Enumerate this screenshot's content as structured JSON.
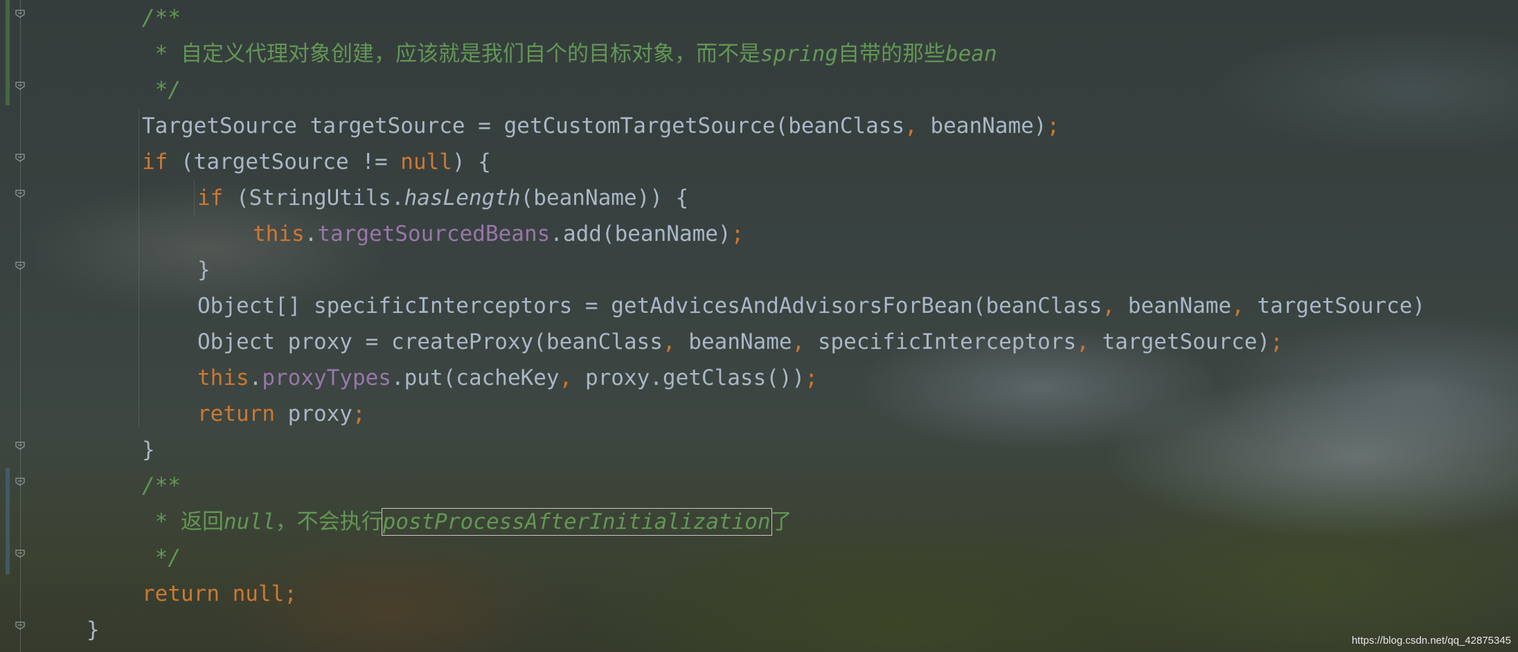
{
  "editor": {
    "lines": [
      {
        "tokens": [
          {
            "t": "/**",
            "c": "cm it"
          }
        ]
      },
      {
        "tokens": [
          {
            "t": " * ",
            "c": "cm it"
          },
          {
            "t": "自定义代理对象创建，应该就是我们自个的目标对象，而不是",
            "c": "cm"
          },
          {
            "t": "spring",
            "c": "cm it"
          },
          {
            "t": "自带的那些",
            "c": "cm"
          },
          {
            "t": "bean",
            "c": "cm it"
          }
        ]
      },
      {
        "tokens": [
          {
            "t": " */",
            "c": "cm it"
          }
        ]
      },
      {
        "tokens": [
          {
            "t": "TargetSource targetSource = getCustomTargetSource(beanClass",
            "c": ""
          },
          {
            "t": ", ",
            "c": "kw"
          },
          {
            "t": "beanName)",
            "c": ""
          },
          {
            "t": ";",
            "c": "kw"
          }
        ]
      },
      {
        "tokens": [
          {
            "t": "if ",
            "c": "kw"
          },
          {
            "t": "(targetSource != ",
            "c": ""
          },
          {
            "t": "null",
            "c": "kw"
          },
          {
            "t": ") {",
            "c": ""
          }
        ]
      },
      {
        "tokens": [
          {
            "t": "if ",
            "c": "kw"
          },
          {
            "t": "(StringUtils.",
            "c": ""
          },
          {
            "t": "hasLength",
            "c": "it"
          },
          {
            "t": "(beanName)) {",
            "c": ""
          }
        ]
      },
      {
        "tokens": [
          {
            "t": "this",
            "c": "kw"
          },
          {
            "t": ".",
            "c": ""
          },
          {
            "t": "targetSourcedBeans",
            "c": "fd"
          },
          {
            "t": ".add(beanName)",
            "c": ""
          },
          {
            "t": ";",
            "c": "kw"
          }
        ]
      },
      {
        "tokens": [
          {
            "t": "}",
            "c": ""
          }
        ]
      },
      {
        "tokens": [
          {
            "t": "Object[] specificInterceptors = getAdvicesAndAdvisorsForBean(beanClass",
            "c": ""
          },
          {
            "t": ", ",
            "c": "kw"
          },
          {
            "t": "beanName",
            "c": ""
          },
          {
            "t": ", ",
            "c": "kw"
          },
          {
            "t": "targetSource)",
            "c": ""
          }
        ]
      },
      {
        "tokens": [
          {
            "t": "Object proxy = createProxy(beanClass",
            "c": ""
          },
          {
            "t": ", ",
            "c": "kw"
          },
          {
            "t": "beanName",
            "c": ""
          },
          {
            "t": ", ",
            "c": "kw"
          },
          {
            "t": "specificInterceptors",
            "c": ""
          },
          {
            "t": ", ",
            "c": "kw"
          },
          {
            "t": "targetSource)",
            "c": ""
          },
          {
            "t": ";",
            "c": "kw"
          }
        ]
      },
      {
        "tokens": [
          {
            "t": "this",
            "c": "kw"
          },
          {
            "t": ".",
            "c": ""
          },
          {
            "t": "proxyTypes",
            "c": "fd"
          },
          {
            "t": ".put(cacheKey",
            "c": ""
          },
          {
            "t": ", ",
            "c": "kw"
          },
          {
            "t": "proxy.getClass())",
            "c": ""
          },
          {
            "t": ";",
            "c": "kw"
          }
        ]
      },
      {
        "tokens": [
          {
            "t": "return ",
            "c": "kw"
          },
          {
            "t": "proxy",
            "c": ""
          },
          {
            "t": ";",
            "c": "kw"
          }
        ]
      },
      {
        "tokens": [
          {
            "t": "}",
            "c": ""
          }
        ]
      },
      {
        "tokens": [
          {
            "t": "/**",
            "c": "cm it"
          }
        ]
      },
      {
        "tokens": [
          {
            "t": " * ",
            "c": "cm it"
          },
          {
            "t": "返回",
            "c": "cm"
          },
          {
            "t": "null",
            "c": "cm it"
          },
          {
            "t": "，不会执行",
            "c": "cm"
          },
          {
            "t": "postProcessAfterInitialization",
            "c": "cm it hl"
          },
          {
            "t": "了",
            "c": "cm"
          }
        ]
      },
      {
        "tokens": [
          {
            "t": " */",
            "c": "cm it"
          }
        ]
      },
      {
        "tokens": [
          {
            "t": "return null;",
            "c": "kw"
          }
        ]
      },
      {
        "tokens": [
          {
            "t": "}",
            "c": ""
          }
        ]
      }
    ]
  },
  "colors": {
    "keyword": "#cc7832",
    "comment": "#629755",
    "field": "#9876aa",
    "text": "#a9b7c6"
  },
  "watermark": "https://blog.csdn.net/qq_42875345"
}
